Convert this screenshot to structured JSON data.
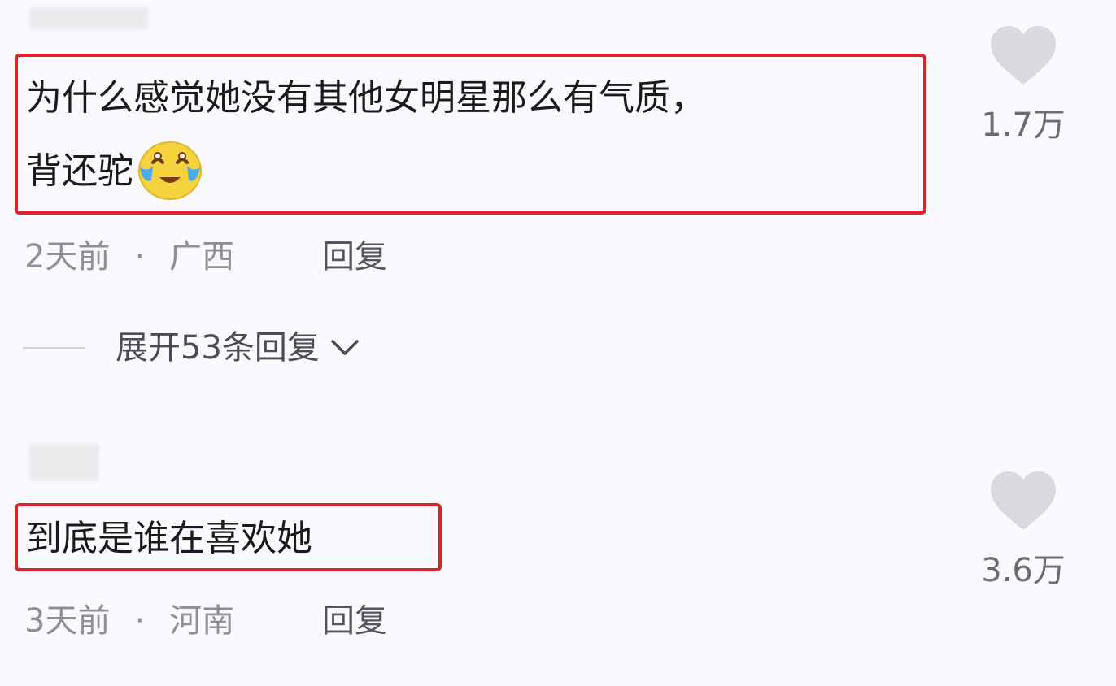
{
  "comments": [
    {
      "text_line1": "为什么感觉她没有其他女明星那么有气质，",
      "text_line2": "背还驼",
      "emoji": "crying-laughing-emoji",
      "time": "2天前",
      "separator": "·",
      "location": "广西",
      "reply_label": "回复",
      "likes": "1.7万",
      "expand_label": "展开53条回复"
    },
    {
      "text_line1": "到底是谁在喜欢她",
      "time": "3天前",
      "separator": "·",
      "location": "河南",
      "reply_label": "回复",
      "likes": "3.6万"
    }
  ],
  "colors": {
    "highlight_border": "#e0202a",
    "background": "#fafafe",
    "heart": "#d9d9de"
  },
  "icons": {
    "like": "heart-icon",
    "expand": "chevron-down-icon"
  }
}
